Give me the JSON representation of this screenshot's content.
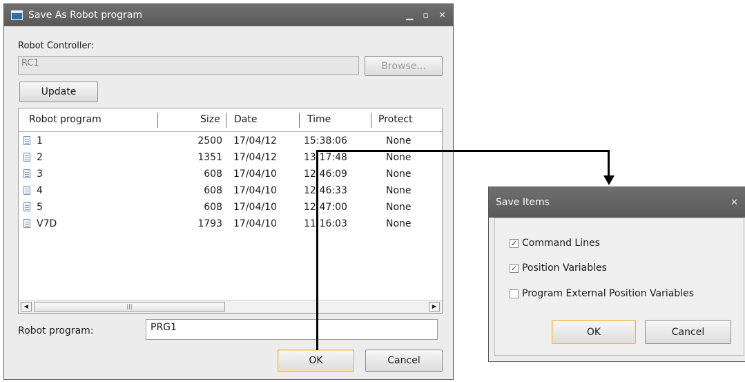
{
  "main_dialog": {
    "title": "Save As Robot program",
    "controller_label": "Robot Controller:",
    "controller_value": "RC1",
    "browse_label": "Browse...",
    "update_label": "Update",
    "columns": [
      "Robot program",
      "Size",
      "Date",
      "Time",
      "Protect"
    ],
    "rows": [
      {
        "name": "1",
        "size": "2500",
        "date": "17/04/12",
        "time": "15:38:06",
        "protect": "None"
      },
      {
        "name": "2",
        "size": "1351",
        "date": "17/04/12",
        "time": "13:17:48",
        "protect": "None"
      },
      {
        "name": "3",
        "size": "608",
        "date": "17/04/10",
        "time": "12:46:09",
        "protect": "None"
      },
      {
        "name": "4",
        "size": "608",
        "date": "17/04/10",
        "time": "12:46:33",
        "protect": "None"
      },
      {
        "name": "5",
        "size": "608",
        "date": "17/04/10",
        "time": "12:47:00",
        "protect": "None"
      },
      {
        "name": "V7D",
        "size": "1793",
        "date": "17/04/10",
        "time": "11:16:03",
        "protect": "None"
      }
    ],
    "program_label": "Robot program:",
    "program_value": "PRG1",
    "ok_label": "OK",
    "cancel_label": "Cancel"
  },
  "save_items_dialog": {
    "title": "Save Items",
    "options": [
      {
        "label": "Command Lines",
        "checked": true
      },
      {
        "label": "Position Variables",
        "checked": true
      },
      {
        "label": "Program External Position Variables",
        "checked": false
      }
    ],
    "ok_label": "OK",
    "cancel_label": "Cancel"
  }
}
